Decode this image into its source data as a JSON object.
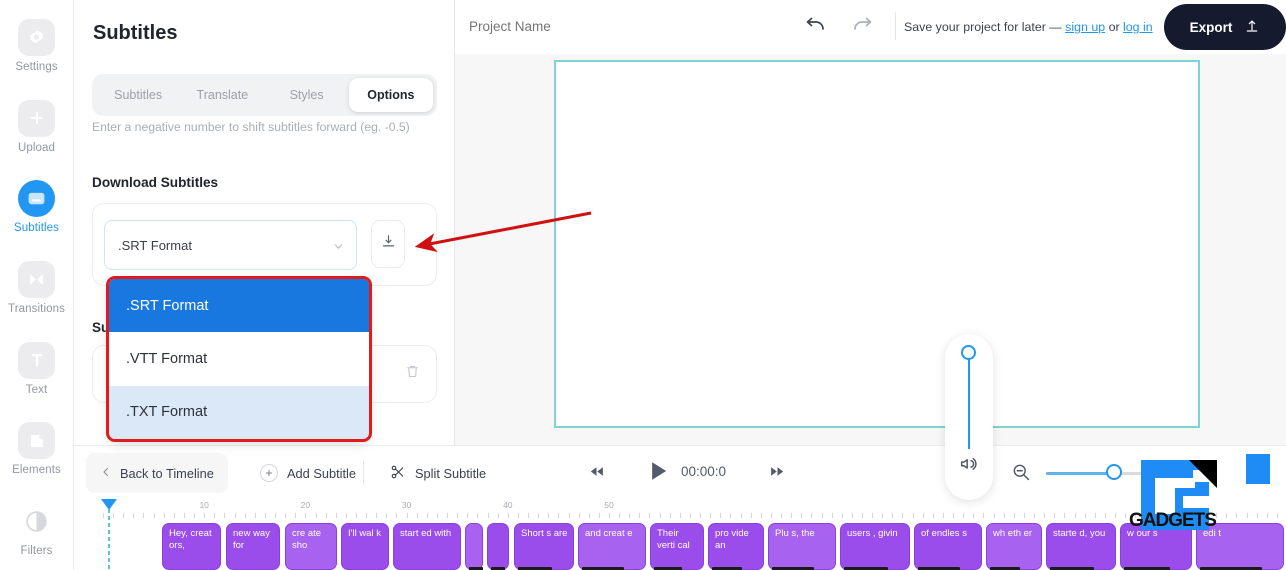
{
  "sidebar": {
    "items": [
      {
        "label": "Settings",
        "icon": "gear-icon",
        "active": false
      },
      {
        "label": "Upload",
        "icon": "plus-square-icon",
        "active": false
      },
      {
        "label": "Subtitles",
        "icon": "subtitles-icon",
        "active": true
      },
      {
        "label": "Transitions",
        "icon": "transitions-icon",
        "active": false
      },
      {
        "label": "Text",
        "icon": "text-icon",
        "active": false
      },
      {
        "label": "Elements",
        "icon": "elements-icon",
        "active": false
      },
      {
        "label": "Filters",
        "icon": "filters-icon",
        "active": false
      }
    ]
  },
  "panel": {
    "title": "Subtitles",
    "tabs": [
      {
        "label": "Subtitles",
        "active": false
      },
      {
        "label": "Translate",
        "active": false
      },
      {
        "label": "Styles",
        "active": false
      },
      {
        "label": "Options",
        "active": true
      }
    ],
    "hint": "Enter a negative number to shift subtitles forward (eg. -0.5)",
    "download_title": "Download Subtitles",
    "format_select": {
      "value": ".SRT Format",
      "chevron_icon": "chevron-down-icon",
      "options": [
        {
          "label": ".SRT Format",
          "state": "selected"
        },
        {
          "label": ".VTT Format",
          "state": "normal"
        },
        {
          "label": ".TXT Format",
          "state": "hover"
        }
      ]
    },
    "download_button_icon": "download-icon",
    "subtitles_row_label": "Su",
    "delete_icon": "trash-icon"
  },
  "topbar": {
    "project_placeholder": "Project Name",
    "undo_icon": "undo-arrow-icon",
    "redo_icon": "redo-arrow-icon",
    "save_prefix": "Save your project for later — ",
    "sign_up": "sign up",
    "save_or": " or ",
    "log_in": "log in",
    "export_label": "Export",
    "export_icon": "upload-icon"
  },
  "player": {
    "volume_icon": "speaker-icon",
    "back_to_timeline": "Back to Timeline",
    "back_icon": "chevron-left-icon",
    "add_subtitle": "Add Subtitle",
    "add_icon": "plus-icon",
    "split_subtitle": "Split Subtitle",
    "split_icon": "scissors-icon",
    "rewind_icon": "rewind-icon",
    "play_icon": "play-icon",
    "current_time": "00:00:0",
    "forward_icon": "fast-forward-icon",
    "zoom_out_icon": "zoom-out-icon",
    "zoom_in_icon": "zoom-in-icon",
    "fullscreen_icon": "fullscreen-icon"
  },
  "timeline": {
    "ruler_labels": [
      "10",
      "20",
      "30",
      "40",
      "50"
    ],
    "clips": [
      {
        "text": "Hey, creat ors,"
      },
      {
        "text": "new way for"
      },
      {
        "text": "cre ate sho"
      },
      {
        "text": "I'll wal k"
      },
      {
        "text": "start ed with"
      },
      {
        "text": ""
      },
      {
        "text": ""
      },
      {
        "text": "Short s are"
      },
      {
        "text": "and creat e"
      },
      {
        "text": "Their verti cal"
      },
      {
        "text": "pro vide an"
      },
      {
        "text": "Plu s, the"
      },
      {
        "text": "users , givin"
      },
      {
        "text": "of endles s"
      },
      {
        "text": "wh eth er"
      },
      {
        "text": "starte d, you"
      },
      {
        "text": "w our s"
      },
      {
        "text": "edi t"
      }
    ]
  },
  "watermark": {
    "text": "GADGETS"
  },
  "colors": {
    "accent": "#2196f3",
    "dropdown_selected": "#1878e0",
    "dropdown_hover": "#dbe8f7",
    "annotation_red": "#e01b1b",
    "clip_purple": "#9b4dec",
    "canvas_border": "#7fd3d3",
    "export_dark": "#161a2e"
  }
}
